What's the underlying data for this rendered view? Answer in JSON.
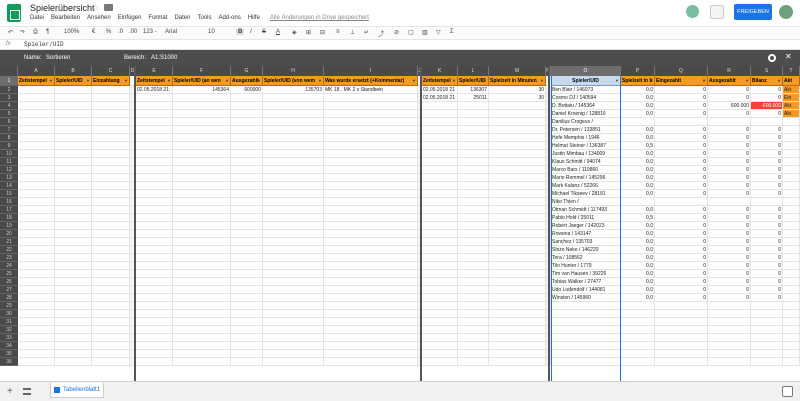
{
  "app": {
    "title": "Spielerübersicht",
    "menus": [
      "Datei",
      "Bearbeiten",
      "Ansehen",
      "Einfügen",
      "Format",
      "Daten",
      "Tools",
      "Add-ons",
      "Hilfe"
    ],
    "saved_status": "Alle Änderungen in Drive gespeichert",
    "share_label": "FREIGEBEN"
  },
  "toolbar": {
    "zoom": "100%",
    "currency": "€",
    "percent": "%",
    "decimals_less": ".0",
    "decimals_more": ".00",
    "number_format": "123 -",
    "font": "Arial",
    "font_size": "10",
    "bold": "B",
    "italic": "I",
    "strike": "S",
    "text_color": "A"
  },
  "formula_bar": {
    "fx": "fx",
    "content": "Spieler/UID"
  },
  "filter_bar": {
    "name_label": "Name:",
    "name_value": "Sortieren",
    "range_label": "Bereich:",
    "range_value": "A1:S1000"
  },
  "grid": {
    "columns": [
      "A",
      "B",
      "C",
      "D",
      "E",
      "F",
      "G",
      "H",
      "I",
      "J",
      "K",
      "L",
      "M",
      "N",
      "O",
      "P",
      "Q",
      "R",
      "S",
      "T"
    ],
    "headers": {
      "A": "Zeitstempel",
      "B": "Spieler/UID",
      "C": "Einzahlung",
      "E": "Zeitstempel",
      "F": "Spieler/UID (an wen",
      "G": "Ausgezahlt",
      "H": "Spieler/UID (von wem",
      "I": "Was wurde ersetzt (+Kommentar)",
      "K": "Zeitstempel",
      "L": "Spieler/UID",
      "M": "Spielzeit in Minuten",
      "O": "Spieler/UID",
      "P": "Spielzeit in h",
      "Q": "Eingezahlt",
      "R": "Ausgezahlt",
      "S": "Bilanz",
      "T": "Akt"
    },
    "row_numbers": [
      "1",
      "2",
      "3",
      "4",
      "5",
      "6",
      "7",
      "8",
      "9",
      "10",
      "11",
      "12",
      "13",
      "14",
      "15",
      "16",
      "17",
      "18",
      "19",
      "20",
      "21",
      "22",
      "23",
      "24",
      "25",
      "26",
      "27",
      "28",
      "29",
      "30",
      "31",
      "32",
      "33",
      "34",
      "35",
      "36"
    ],
    "left_rows": [
      {
        "e": "02.05.2018 21:",
        "f": "145364",
        "g": "600000",
        "h": "135703",
        "i": "MK 18 , MK 2 x Standbein",
        "k": "02.05.2018 21",
        "l": "136307",
        "m": "30"
      },
      {
        "e": "",
        "f": "",
        "g": "",
        "h": "",
        "i": "",
        "k": "02.05.2018 21",
        "l": "25011",
        "m": "30"
      }
    ],
    "players": [
      {
        "name": "Ben Blair / 146073",
        "p": "0,0",
        "q": "0",
        "r": "0",
        "s": "0",
        "t": "Akt"
      },
      {
        "name": "Cosmo DJ / 140594",
        "p": "0,0",
        "q": "0",
        "r": "0",
        "s": "0",
        "t": "Ein"
      },
      {
        "name": "D. Bottaiu / 145364",
        "p": "0,0",
        "q": "0",
        "r": "600.000",
        "s": "-600.000",
        "t": "Akt"
      },
      {
        "name": "Daniel Kroenig / 128816",
        "p": "0,0",
        "q": "0",
        "r": "0",
        "s": "0",
        "t": "Akt"
      },
      {
        "name": "Danilius Crogeus /",
        "p": "",
        "q": "",
        "r": "",
        "s": "",
        "t": ""
      },
      {
        "name": "Dr. Petersen / 133851",
        "p": "0,0",
        "q": "0",
        "r": "0",
        "s": "0",
        "t": ""
      },
      {
        "name": "Hefe Memphis / 1946",
        "p": "0,0",
        "q": "0",
        "r": "0",
        "s": "0",
        "t": ""
      },
      {
        "name": "Helmut Steiner / 136387",
        "p": "0,5",
        "q": "0",
        "r": "0",
        "s": "0",
        "t": ""
      },
      {
        "name": "Justin Mimbau / 134009",
        "p": "0,0",
        "q": "0",
        "r": "0",
        "s": "0",
        "t": ""
      },
      {
        "name": "Klaus Schmitt / 94074",
        "p": "0,0",
        "q": "0",
        "r": "0",
        "s": "0",
        "t": ""
      },
      {
        "name": "Marco Bars / 119860",
        "p": "0,0",
        "q": "0",
        "r": "0",
        "s": "0",
        "t": ""
      },
      {
        "name": "Mario Rommel / 145296",
        "p": "0,0",
        "q": "0",
        "r": "0",
        "s": "0",
        "t": ""
      },
      {
        "name": "Mark Kalanz / 52266",
        "p": "0,0",
        "q": "0",
        "r": "0",
        "s": "0",
        "t": ""
      },
      {
        "name": "Michael Tikseev / 28181",
        "p": "0,0",
        "q": "0",
        "r": "0",
        "s": "0",
        "t": ""
      },
      {
        "name": "Niko Thien /",
        "p": "",
        "q": "",
        "r": "",
        "s": "",
        "t": ""
      },
      {
        "name": "Otman Schmidt / 117493",
        "p": "0,0",
        "q": "0",
        "r": "0",
        "s": "0",
        "t": ""
      },
      {
        "name": "Pablo Hold / 25011",
        "p": "0,5",
        "q": "0",
        "r": "0",
        "s": "0",
        "t": ""
      },
      {
        "name": "Robert Jaeger / 142023",
        "p": "0,0",
        "q": "0",
        "r": "0",
        "s": "0",
        "t": ""
      },
      {
        "name": "Rowena / 143147",
        "p": "0,0",
        "q": "0",
        "r": "0",
        "s": "0",
        "t": ""
      },
      {
        "name": "Sanchez / 135703",
        "p": "0,0",
        "q": "0",
        "r": "0",
        "s": "0",
        "t": ""
      },
      {
        "name": "Shizo Neko / 146220",
        "p": "0,0",
        "q": "0",
        "r": "0",
        "s": "0",
        "t": ""
      },
      {
        "name": "Tera / 108562",
        "p": "0,0",
        "q": "0",
        "r": "0",
        "s": "0",
        "t": ""
      },
      {
        "name": "Tilo Hunter / 1779",
        "p": "0,0",
        "q": "0",
        "r": "0",
        "s": "0",
        "t": ""
      },
      {
        "name": "Tim van Hausen / 39226",
        "p": "0,0",
        "q": "0",
        "r": "0",
        "s": "0",
        "t": ""
      },
      {
        "name": "Tobias Walker / 27477",
        "p": "0,0",
        "q": "0",
        "r": "0",
        "s": "0",
        "t": ""
      },
      {
        "name": "Udo Ludendolf / 144081",
        "p": "0,0",
        "q": "0",
        "r": "0",
        "s": "0",
        "t": ""
      },
      {
        "name": "Winston / 145960",
        "p": "0,0",
        "q": "0",
        "r": "0",
        "s": "0",
        "t": ""
      }
    ]
  },
  "sheets": {
    "active": "Tabellenblatt1"
  },
  "colors": {
    "header_orange": "#f59a23",
    "header_blue": "#c7d9ee",
    "negative_red": "#f44336",
    "share_blue": "#1a73e8",
    "filter_bar": "#4d4d4d"
  }
}
